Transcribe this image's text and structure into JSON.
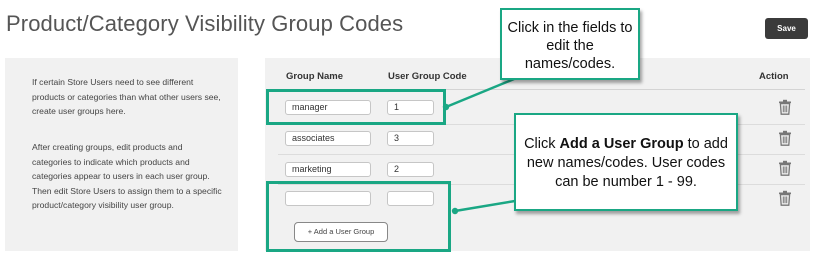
{
  "page": {
    "title": "Product/Category Visibility Group Codes",
    "save_label": "Save"
  },
  "info": {
    "paragraph1": "If certain Store Users need to see different products or categories than what other users see, create user groups here.",
    "paragraph2": "After creating groups, edit products and categories to indicate which products and categories appear to users in each user group. Then edit Store Users to assign them to a specific product/category visibility user group."
  },
  "table": {
    "headers": {
      "group_name": "Group Name",
      "user_group_code": "User Group Code",
      "action": "Action"
    },
    "rows": [
      {
        "name": "manager",
        "code": "1"
      },
      {
        "name": "associates",
        "code": "3"
      },
      {
        "name": "marketing",
        "code": "2"
      },
      {
        "name": "",
        "code": ""
      }
    ],
    "add_label": "+ Add a User Group"
  },
  "callouts": {
    "edit_text": "Click in the fields to edit the names/codes.",
    "add_prefix": "Click ",
    "add_bold": "Add a User Group",
    "add_suffix": " to add new names/codes. User codes can be number 1 - 99."
  },
  "colors": {
    "highlight": "#1aa784",
    "save_button": "#3b3b3b",
    "panel_background": "#f1f1f1"
  },
  "icons": {
    "row_action": "trash-icon"
  }
}
